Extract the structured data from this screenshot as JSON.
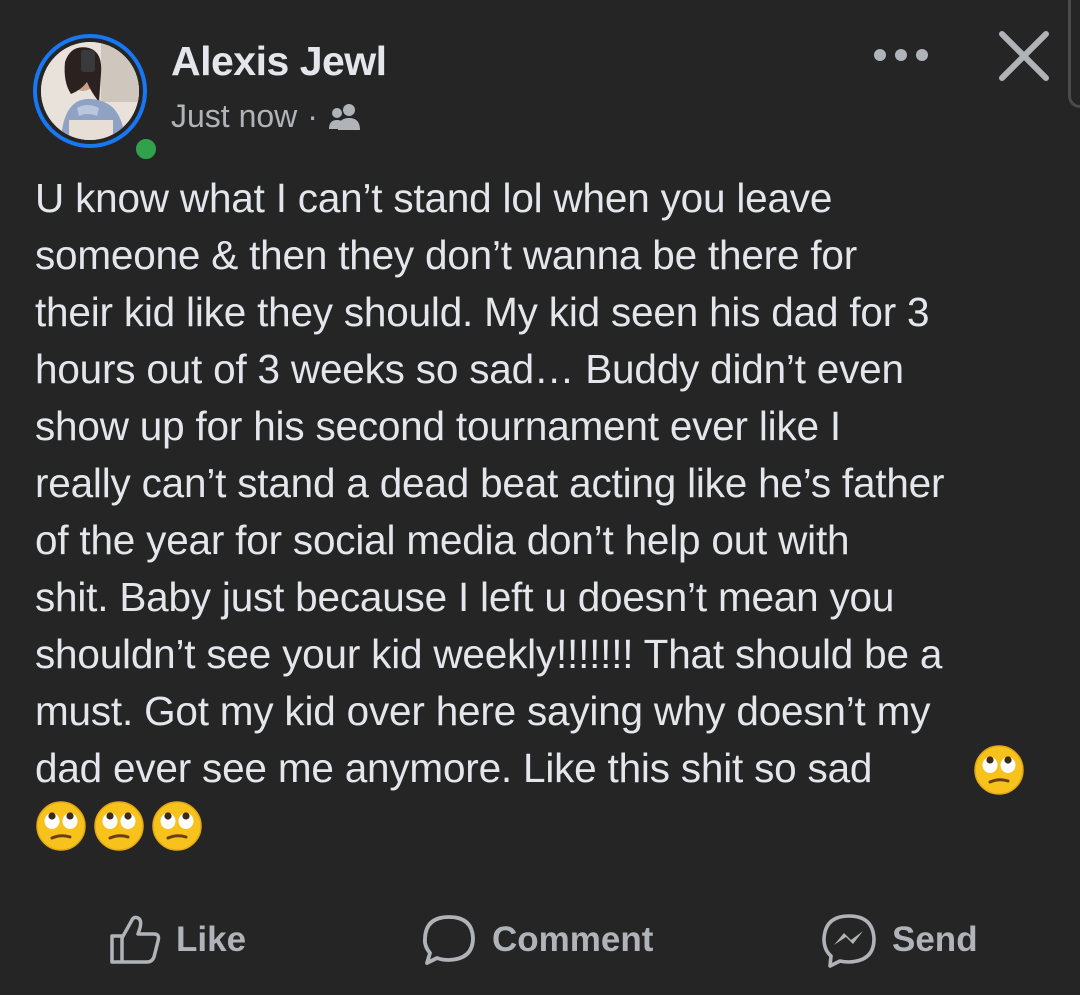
{
  "post": {
    "author": "Alexis Jewl",
    "timestamp": "Just now",
    "separator": "·",
    "audience_icon": "friends-icon",
    "text": "U know what I can’t stand lol when you leave\nsomeone & then they don’t wanna be there for\ntheir kid like they should. My kid seen his dad for 3\nhours out of 3 weeks so sad… Buddy didn’t even\nshow up for his second tournament ever like I\nreally can’t stand a dead beat acting like he’s father\nof the year for social media don’t help out with\nshit. Baby just because I left u doesn’t mean you\nshouldn’t see your kid weekly!!!!!!! That should be a\nmust. Got my kid over here saying why doesn’t my\ndad ever see me anymore. Like this shit so sad",
    "emojis": [
      "face-with-rolling-eyes",
      "face-with-rolling-eyes",
      "face-with-rolling-eyes",
      "face-with-rolling-eyes"
    ]
  },
  "header": {
    "more_icon": "more-options-icon",
    "close_icon": "close-icon"
  },
  "actions": {
    "like_label": "Like",
    "comment_label": "Comment",
    "send_label": "Send"
  },
  "colors": {
    "background": "#252526",
    "text": "#e4e6eb",
    "secondary_text": "#b0b3b8",
    "story_ring": "#1877f2",
    "online": "#31a24c"
  }
}
